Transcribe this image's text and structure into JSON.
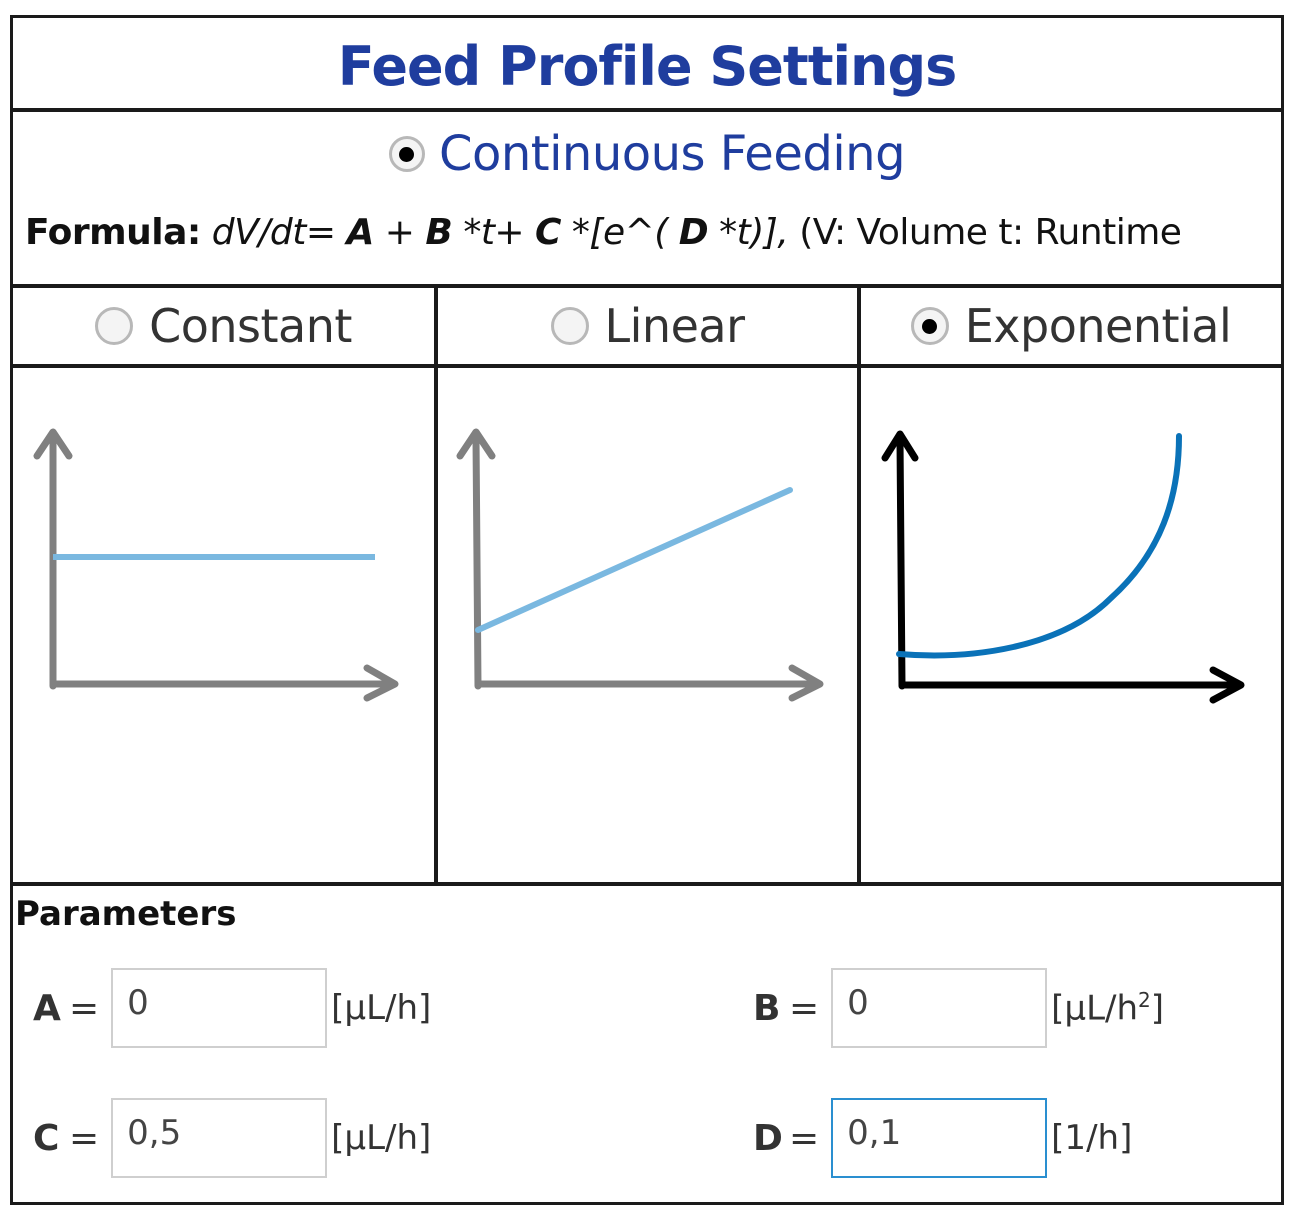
{
  "header": {
    "title": "Feed Profile Settings"
  },
  "mode": {
    "label": "Continuous Feeding",
    "selected": true
  },
  "formula": {
    "label": "Formula:",
    "parts": {
      "lhs": "dV/dt=",
      "A": "A",
      "plus1": "+",
      "B": "B",
      "t1": "*t+",
      "C": "C",
      "exp_open": "*[e^(",
      "D": "D",
      "exp_close": "*t)],",
      "legend": "(V: Volume t: Runtime"
    }
  },
  "profile_types": [
    {
      "label": "Constant",
      "selected": false,
      "icon": "constant-profile-icon"
    },
    {
      "label": "Linear",
      "selected": false,
      "icon": "linear-profile-icon"
    },
    {
      "label": "Exponential",
      "selected": true,
      "icon": "exponential-profile-icon"
    }
  ],
  "colors": {
    "title_blue": "#1f3d9e",
    "curve_light_blue": "#7ab8e0",
    "curve_active_blue": "#0a72b8",
    "axis_inactive": "#808080",
    "axis_active": "#000000",
    "focus_border": "#2a8fd0"
  },
  "parameters": {
    "title": "Parameters",
    "A": {
      "name": "A",
      "eq": "=",
      "value": "0",
      "unit": "[µL/h]"
    },
    "B": {
      "name": "B",
      "eq": "=",
      "value": "0",
      "unit_base": "[µL/h",
      "unit_sup": "2",
      "unit_end": "]"
    },
    "C": {
      "name": "C",
      "eq": "=",
      "value": "0,5",
      "unit": "[µL/h]"
    },
    "D": {
      "name": "D",
      "eq": "=",
      "value": "0,1",
      "unit": "[1/h]",
      "focused": true
    }
  }
}
